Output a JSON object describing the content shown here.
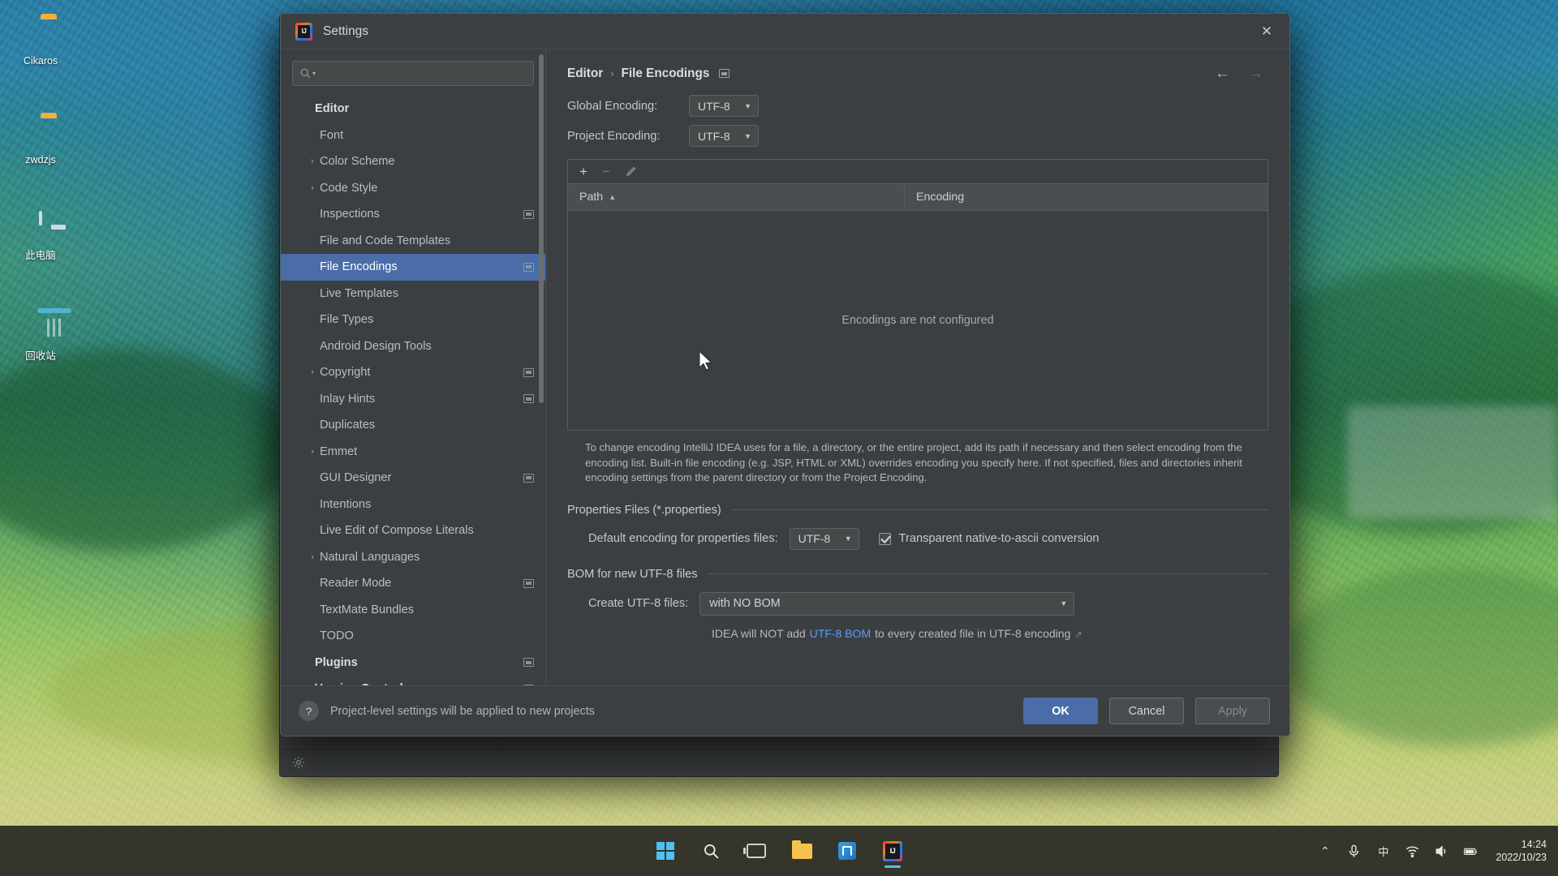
{
  "desktop": {
    "icons": [
      {
        "name": "Cikaros",
        "kind": "folder"
      },
      {
        "name": "zwdzjs",
        "kind": "folder"
      },
      {
        "name": "此电脑",
        "kind": "computer"
      },
      {
        "name": "回收站",
        "kind": "recycle-bin"
      }
    ]
  },
  "dialog": {
    "title": "Settings",
    "close_label": "✕",
    "search": {
      "value": "",
      "placeholder": ""
    },
    "tree": [
      {
        "label": "Editor",
        "level": 0,
        "arrow": "",
        "group": true,
        "badge": false,
        "selected": false
      },
      {
        "label": "Font",
        "level": 1,
        "arrow": "",
        "group": false,
        "badge": false,
        "selected": false
      },
      {
        "label": "Color Scheme",
        "level": 1,
        "arrow": "›",
        "group": false,
        "badge": false,
        "selected": false
      },
      {
        "label": "Code Style",
        "level": 1,
        "arrow": "›",
        "group": false,
        "badge": false,
        "selected": false
      },
      {
        "label": "Inspections",
        "level": 1,
        "arrow": "",
        "group": false,
        "badge": true,
        "selected": false
      },
      {
        "label": "File and Code Templates",
        "level": 1,
        "arrow": "",
        "group": false,
        "badge": false,
        "selected": false
      },
      {
        "label": "File Encodings",
        "level": 1,
        "arrow": "",
        "group": false,
        "badge": true,
        "selected": true
      },
      {
        "label": "Live Templates",
        "level": 1,
        "arrow": "",
        "group": false,
        "badge": false,
        "selected": false
      },
      {
        "label": "File Types",
        "level": 1,
        "arrow": "",
        "group": false,
        "badge": false,
        "selected": false
      },
      {
        "label": "Android Design Tools",
        "level": 1,
        "arrow": "",
        "group": false,
        "badge": false,
        "selected": false
      },
      {
        "label": "Copyright",
        "level": 1,
        "arrow": "›",
        "group": false,
        "badge": true,
        "selected": false
      },
      {
        "label": "Inlay Hints",
        "level": 1,
        "arrow": "",
        "group": false,
        "badge": true,
        "selected": false
      },
      {
        "label": "Duplicates",
        "level": 1,
        "arrow": "",
        "group": false,
        "badge": false,
        "selected": false
      },
      {
        "label": "Emmet",
        "level": 1,
        "arrow": "›",
        "group": false,
        "badge": false,
        "selected": false
      },
      {
        "label": "GUI Designer",
        "level": 1,
        "arrow": "",
        "group": false,
        "badge": true,
        "selected": false
      },
      {
        "label": "Intentions",
        "level": 1,
        "arrow": "",
        "group": false,
        "badge": false,
        "selected": false
      },
      {
        "label": "Live Edit of Compose Literals",
        "level": 1,
        "arrow": "",
        "group": false,
        "badge": false,
        "selected": false
      },
      {
        "label": "Natural Languages",
        "level": 1,
        "arrow": "›",
        "group": false,
        "badge": false,
        "selected": false
      },
      {
        "label": "Reader Mode",
        "level": 1,
        "arrow": "",
        "group": false,
        "badge": true,
        "selected": false
      },
      {
        "label": "TextMate Bundles",
        "level": 1,
        "arrow": "",
        "group": false,
        "badge": false,
        "selected": false
      },
      {
        "label": "TODO",
        "level": 1,
        "arrow": "",
        "group": false,
        "badge": false,
        "selected": false
      },
      {
        "label": "Plugins",
        "level": 0,
        "arrow": "",
        "group": true,
        "badge": true,
        "selected": false
      },
      {
        "label": "Version Control",
        "level": 0,
        "arrow": "›",
        "group": true,
        "badge": true,
        "selected": false
      }
    ],
    "breadcrumb": {
      "parent": "Editor",
      "separator": "›",
      "current": "File Encodings"
    },
    "nav": {
      "back": "←",
      "forward": "→"
    },
    "encodings": {
      "global_label": "Global Encoding:",
      "global_value": "UTF-8",
      "project_label": "Project Encoding:",
      "project_value": "UTF-8",
      "toolbar": {
        "add": "+",
        "remove": "−",
        "edit": "edit-pencil"
      },
      "columns": [
        "Path",
        "Encoding"
      ],
      "sort_indicator": "▲",
      "rows": [],
      "empty_message": "Encodings are not configured",
      "hint": "To change encoding IntelliJ IDEA uses for a file, a directory, or the entire project, add its path if necessary and then select encoding from the encoding list. Built-in file encoding (e.g. JSP, HTML or XML) overrides encoding you specify here. If not specified, files and directories inherit encoding settings from the parent directory or from the Project Encoding."
    },
    "properties_section": {
      "title": "Properties Files (*.properties)",
      "default_encoding_label": "Default encoding for properties files:",
      "default_encoding_value": "UTF-8",
      "transparent_label": "Transparent native-to-ascii conversion",
      "transparent_checked": true
    },
    "bom_section": {
      "title": "BOM for new UTF-8 files",
      "create_label": "Create UTF-8 files:",
      "create_value": "with NO BOM",
      "note_prefix": "IDEA will NOT add",
      "note_link": "UTF-8 BOM",
      "note_suffix": "to every created file in UTF-8 encoding",
      "note_external_icon": "↗"
    },
    "footer": {
      "help": "?",
      "note": "Project-level settings will be applied to new projects",
      "ok": "OK",
      "cancel": "Cancel",
      "apply": "Apply"
    }
  },
  "taskbar": {
    "apps": [
      {
        "name": "start-button",
        "icon": "windows-logo"
      },
      {
        "name": "search-button",
        "icon": "search-icon"
      },
      {
        "name": "task-view-button",
        "icon": "task-view-icon"
      },
      {
        "name": "file-explorer",
        "icon": "folder-icon"
      },
      {
        "name": "microsoft-store",
        "icon": "store-icon"
      },
      {
        "name": "intellij-idea",
        "icon": "intellij-icon"
      }
    ],
    "tray": {
      "chevron": "⌃",
      "mic": "microphone-icon",
      "ime": "中",
      "network": "wifi-icon",
      "volume": "volume-icon",
      "battery": "battery-icon",
      "time": "14:24",
      "date": "2022/10/23"
    }
  },
  "colors": {
    "accent": "#4a6da7",
    "link": "#589df6",
    "dialog_bg": "#3c3f41",
    "selected_row": "#4a6da7"
  }
}
